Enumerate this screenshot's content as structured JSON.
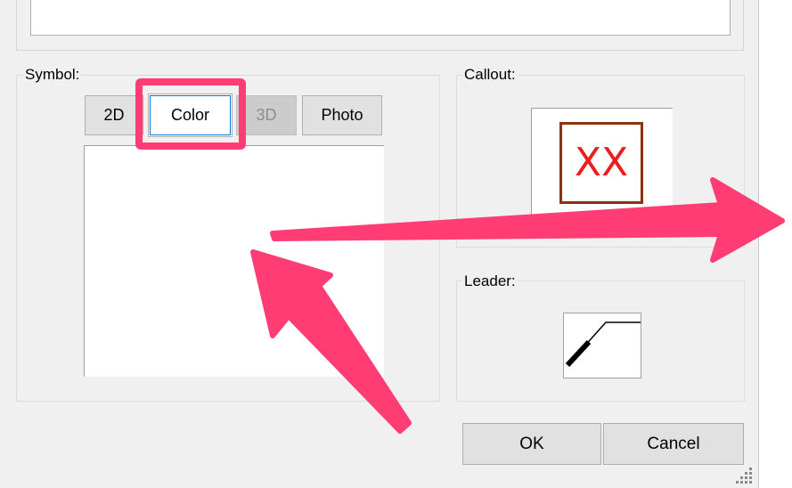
{
  "symbol": {
    "label": "Symbol:",
    "tabs": [
      {
        "label": "2D",
        "state": "normal"
      },
      {
        "label": "Color",
        "state": "selected"
      },
      {
        "label": "3D",
        "state": "disabled"
      },
      {
        "label": "Photo",
        "state": "normal"
      }
    ]
  },
  "callout": {
    "label": "Callout:",
    "preview_text": "XX",
    "text_color": "#ee1c1c",
    "frame_color": "#8b3310"
  },
  "leader": {
    "label": "Leader:"
  },
  "buttons": {
    "ok": "OK",
    "cancel": "Cancel"
  },
  "annotation": {
    "highlight_color": "#ff3d74",
    "arrow_color": "#ff3d74"
  }
}
